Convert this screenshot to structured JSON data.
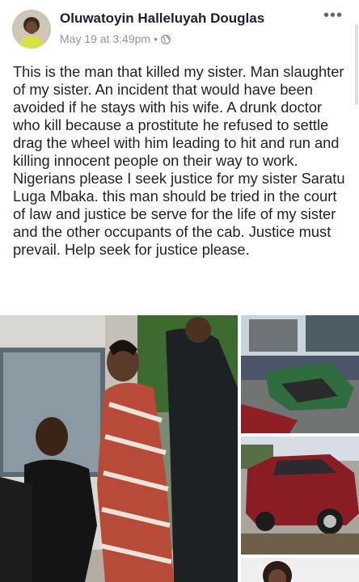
{
  "post": {
    "author": "Oluwatoyin Halleluyah Douglas",
    "date": "May 19 at 3:49pm",
    "separator": "•",
    "privacy_icon": "globe-icon",
    "more_label": "•••",
    "text": "This is the man that killed my sister. Man slaughter of my sister. An incident that would have been avoided if he stays with his wife. A drunk doctor who kill because a prostitute he refused to settle drag the wheel with him leading to hit and run and killing innocent people on their way to work. Nigerians please I seek justice for my sister Saratu Luga Mbaka. this man should be tried in the court of law and justice be serve for the life of my sister and the other  occupants of the cab. Justice must prevail. Help seek for justice please."
  },
  "photos": [
    {
      "subject": "man-seated-with-woman-and-officer"
    },
    {
      "subject": "wrecked-green-car-on-road"
    },
    {
      "subject": "damaged-red-suv"
    },
    {
      "subject": "woman-portrait-partial"
    }
  ],
  "colors": {
    "name_text": "#1d2129",
    "meta_text": "#90949c",
    "body_text": "#1d2129"
  }
}
